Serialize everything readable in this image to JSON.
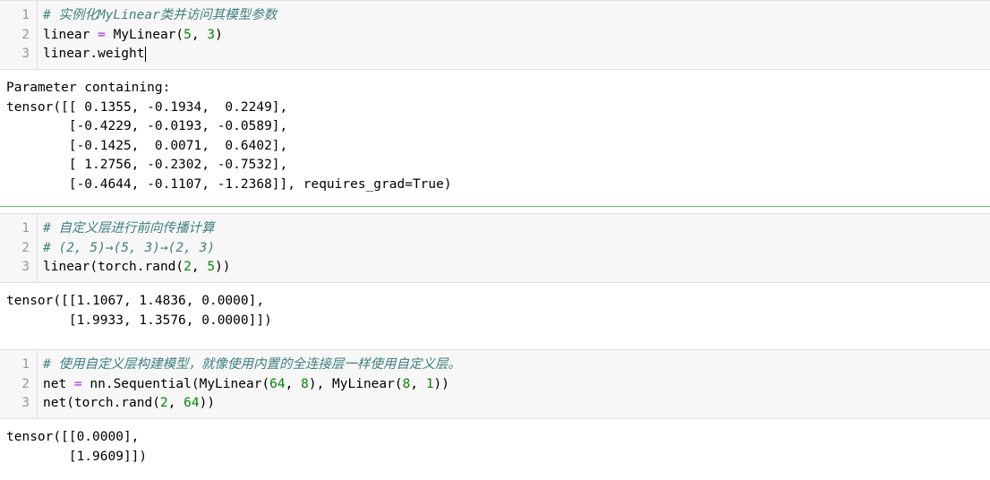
{
  "cells": [
    {
      "input": {
        "line_numbers": [
          "1",
          "2",
          "3"
        ],
        "lines": [
          {
            "comment": "# 实例化MyLinear类并访问其模型参数"
          },
          {
            "pre": "linear ",
            "op": "=",
            "mid": " MyLinear(",
            "n1": "5",
            "sep": ", ",
            "n2": "3",
            "post": ")"
          },
          {
            "pre": "linear.weight"
          }
        ]
      },
      "output": [
        "Parameter containing:",
        "tensor([[ 0.1355, -0.1934,  0.2249],",
        "        [-0.4229, -0.0193, -0.0589],",
        "        [-0.1425,  0.0071,  0.6402],",
        "        [ 1.2756, -0.2302, -0.7532],",
        "        [-0.4644, -0.1107, -1.2368]], requires_grad=True)"
      ]
    },
    {
      "input": {
        "line_numbers": [
          "1",
          "2",
          "3"
        ],
        "lines": [
          {
            "comment": "# 自定义层进行前向传播计算"
          },
          {
            "comment": "# (2, 5)→(5, 3)→(2, 3)"
          },
          {
            "pre": "linear(torch.rand(",
            "n1": "2",
            "sep": ", ",
            "n2": "5",
            "post": "))"
          }
        ]
      },
      "output": [
        "tensor([[1.1067, 1.4836, 0.0000],",
        "        [1.9933, 1.3576, 0.0000]])"
      ]
    },
    {
      "input": {
        "line_numbers": [
          "1",
          "2",
          "3"
        ],
        "lines": [
          {
            "comment": "# 使用自定义层构建模型，就像使用内置的全连接层一样使用自定义层。"
          },
          {
            "pre": "net ",
            "op": "=",
            "mid": " nn.Sequential(MyLinear(",
            "n1": "64",
            "sep": ", ",
            "n2": "8",
            "mid2": "), MyLinear(",
            "n3": "8",
            "sep2": ", ",
            "n4": "1",
            "post": "))"
          },
          {
            "pre": "net(torch.rand(",
            "n1": "2",
            "sep": ", ",
            "n2": "64",
            "post": "))"
          }
        ]
      },
      "output": [
        "tensor([[0.0000],",
        "        [1.9609]])"
      ]
    }
  ]
}
